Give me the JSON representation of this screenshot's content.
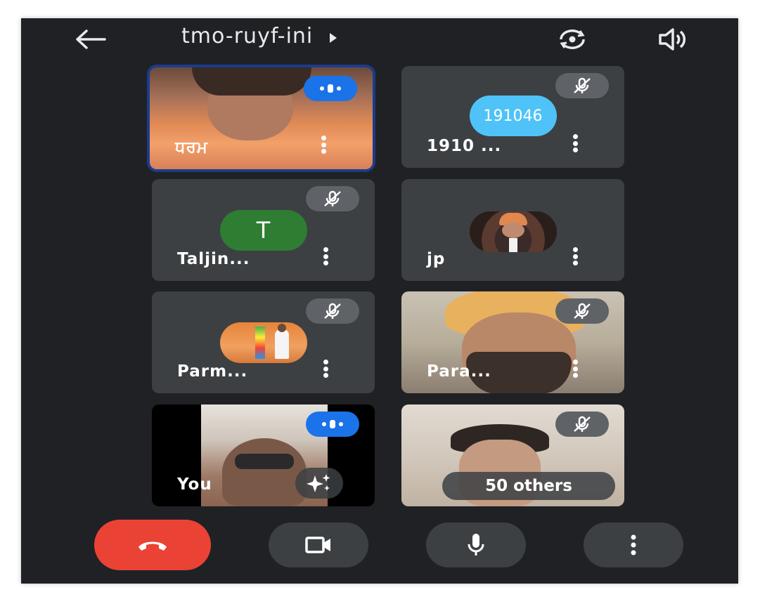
{
  "header": {
    "meeting_code": "tmo-ruyf-ini",
    "back_icon": "arrow-left-icon",
    "switch_camera_icon": "flip-camera-icon",
    "audio_output_icon": "speaker-icon"
  },
  "participants": [
    {
      "name": "ਧਰਮ",
      "state": "speaking",
      "video": true,
      "active": true
    },
    {
      "name": "1910 ...",
      "state": "muted",
      "video": false,
      "avatar_text": "191046",
      "avatar_color": "#4fc3f7"
    },
    {
      "name": "Taljin...",
      "state": "muted",
      "video": false,
      "avatar_text": "T",
      "avatar_color": "#2e7d32"
    },
    {
      "name": "jp",
      "state": "none",
      "video": false,
      "avatar": "photo"
    },
    {
      "name": "Parm...",
      "state": "muted",
      "video": false,
      "avatar": "photo"
    },
    {
      "name": "Para...",
      "state": "muted",
      "video": true
    },
    {
      "name": "You",
      "state": "speaking",
      "video": true,
      "effects_icon": "sparkle-effects-icon"
    },
    {
      "name": "",
      "state": "muted",
      "video": true,
      "others_label": "50 others"
    }
  ],
  "controls": {
    "end_call_icon": "end-call-icon",
    "camera_icon": "video-camera-icon",
    "mic_icon": "microphone-icon",
    "more_icon": "more-vertical-icon"
  },
  "colors": {
    "background": "#202124",
    "tile": "#3c4043",
    "accent_blue": "#1a73e8",
    "end_call_red": "#ea4335",
    "mute_badge": "#5f6368"
  }
}
